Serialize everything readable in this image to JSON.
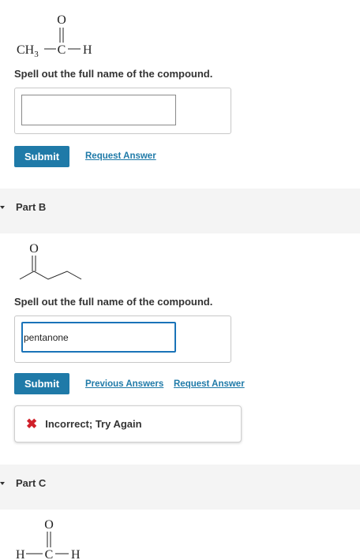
{
  "part_a": {
    "structure": {
      "ch3": "CH",
      "sub3": "3",
      "c": "C",
      "o": "O",
      "h": "H"
    },
    "prompt": "Spell out the full name of the compound.",
    "input_value": "",
    "submit_label": "Submit",
    "request_answer_label": "Request Answer"
  },
  "part_b": {
    "title": "Part B",
    "structure": {
      "o": "O"
    },
    "prompt": "Spell out the full name of the compound.",
    "input_value": "pentanone",
    "submit_label": "Submit",
    "previous_answers_label": "Previous Answers",
    "request_answer_label": "Request Answer",
    "feedback": {
      "icon": "x-icon",
      "text": "Incorrect; Try Again",
      "color": "#d0202a"
    }
  },
  "part_c": {
    "title": "Part C",
    "structure": {
      "o": "O",
      "h_left": "H",
      "c": "C",
      "h_right": "H"
    }
  },
  "colors": {
    "accent": "#1f7aa8",
    "error": "#d0202a",
    "band": "#f4f4f4"
  }
}
